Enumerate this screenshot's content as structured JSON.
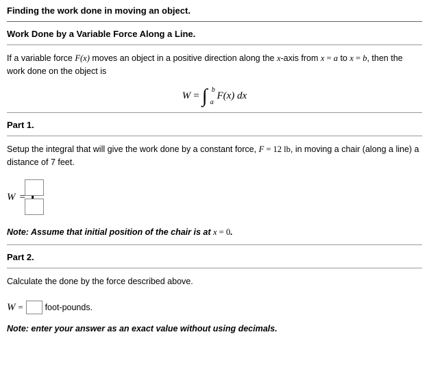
{
  "title": "Finding the work done in moving an object.",
  "theory": {
    "heading": "Work Done by a Variable Force Along a Line.",
    "intro_pre": "If a variable force ",
    "intro_fx": "F(x)",
    "intro_mid": " moves an object in a positive direction along the ",
    "intro_axis": "x",
    "intro_mid2": "-axis from ",
    "intro_a_lhs": "x",
    "intro_eq": " = ",
    "intro_a_rhs": "a",
    "intro_to": " to ",
    "intro_b_lhs": "x",
    "intro_b_rhs": "b",
    "intro_end": ", then the work done on the object is",
    "formula_W": "W",
    "formula_eq": " = ",
    "formula_int_lower": "a",
    "formula_int_upper": "b",
    "formula_integrand_F": "F",
    "formula_integrand_x": "(x)",
    "formula_dx_d": " d",
    "formula_dx_x": "x"
  },
  "part1": {
    "heading": "Part 1.",
    "setup_pre": "Setup the integral that will give the work done by a constant force, ",
    "setup_F": "F",
    "setup_eq": " = ",
    "setup_val": "12 lb",
    "setup_mid": ", in moving a chair (along a line) a distance of ",
    "setup_dist": "7",
    "setup_end": " feet.",
    "W_label": "W",
    "eq_sign": " = ",
    "note_pre": "Note: Assume that initial position of the chair is at ",
    "note_x": "x",
    "note_eq": " = ",
    "note_val": "0",
    "note_end": "."
  },
  "part2": {
    "heading": "Part 2.",
    "calc_text": "Calculate the done by the force described above.",
    "W_label": "W",
    "eq_sign": " = ",
    "units": " foot-pounds.",
    "note": "Note: enter your answer as an exact value without using decimals."
  }
}
